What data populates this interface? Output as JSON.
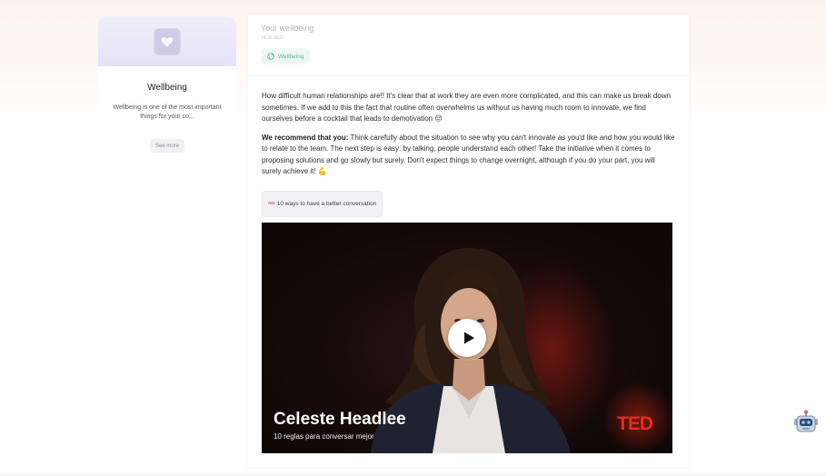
{
  "sidebar": {
    "card_title": "Wellbeing",
    "card_description": "Wellbeing is one of the most important things for your co...",
    "see_more_label": "See more",
    "banner_icon": "heart-icon"
  },
  "header": {
    "title": "Your wellbeing",
    "date": "14.06.2022",
    "chip_label": "Wellbeing",
    "chip_icon": "globe-icon"
  },
  "content": {
    "paragraph_1": "How difficult human relationships are!! It's clear that at work they are even more complicated, and this can make us break down sometimes. If we add to this the fact that routine often overwhelms us without us having much room to innovate, we find ourselves before a cocktail that leads to demotivation",
    "paragraph_1_emoji": "😔",
    "paragraph_2_bold": "We recommend that you:",
    "paragraph_2": " Think carefully about the situation to see why you can't innovate as you'd like and how you would like to relate to the team. The next step is easy: by talking, people understand each other! Take the initiative when it comes to proposing solutions and go slowly but surely. Don't expect things to change overnight, although if you do your part, you will surely achieve it!",
    "paragraph_2_emoji": "💪",
    "resource_button": {
      "badge": "TED",
      "label": "10 ways to have a better conversation"
    }
  },
  "video": {
    "speaker_name": "Celeste Headlee",
    "subtitle": "10 reglas para conversar mejor",
    "brand": "TED",
    "play_icon": "play-icon"
  },
  "assistant": {
    "icon": "robot-icon"
  },
  "colors": {
    "chip_text": "#5fb39e",
    "chip_bg": "#eef7f4",
    "ted_red": "#e62b1e",
    "banner_bg": "#e5e3f7"
  }
}
